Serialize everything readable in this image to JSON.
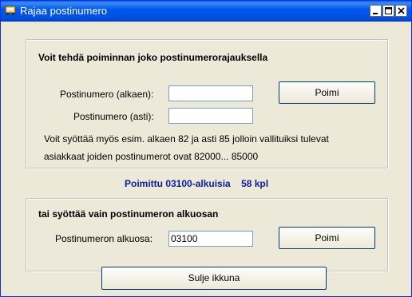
{
  "window": {
    "title": "Rajaa postinumero"
  },
  "range_group": {
    "heading": "Voit tehdä poiminnan joko postinumerorajauksella",
    "from_label": "Postinumero (alkaen):",
    "from_value": "",
    "to_label": "Postinumero (asti):",
    "to_value": "",
    "pick_button": "Poimi",
    "hint_line1": "Voit syöttää myös esim. alkaen 82 ja asti 85 jolloin vallituiksi tulevat",
    "hint_line2": "asiakkaat joiden postinumerot ovat 82000... 85000"
  },
  "status": {
    "text": "Poimittu 03100-alkuisia",
    "count": "58 kpl"
  },
  "prefix_group": {
    "heading": "tai syöttää vain postinumeron alkuosan",
    "prefix_label": "Postinumeron alkuosa:",
    "prefix_value": "03100",
    "pick_button": "Poimi"
  },
  "close_button": "Sulje ikkuna"
}
